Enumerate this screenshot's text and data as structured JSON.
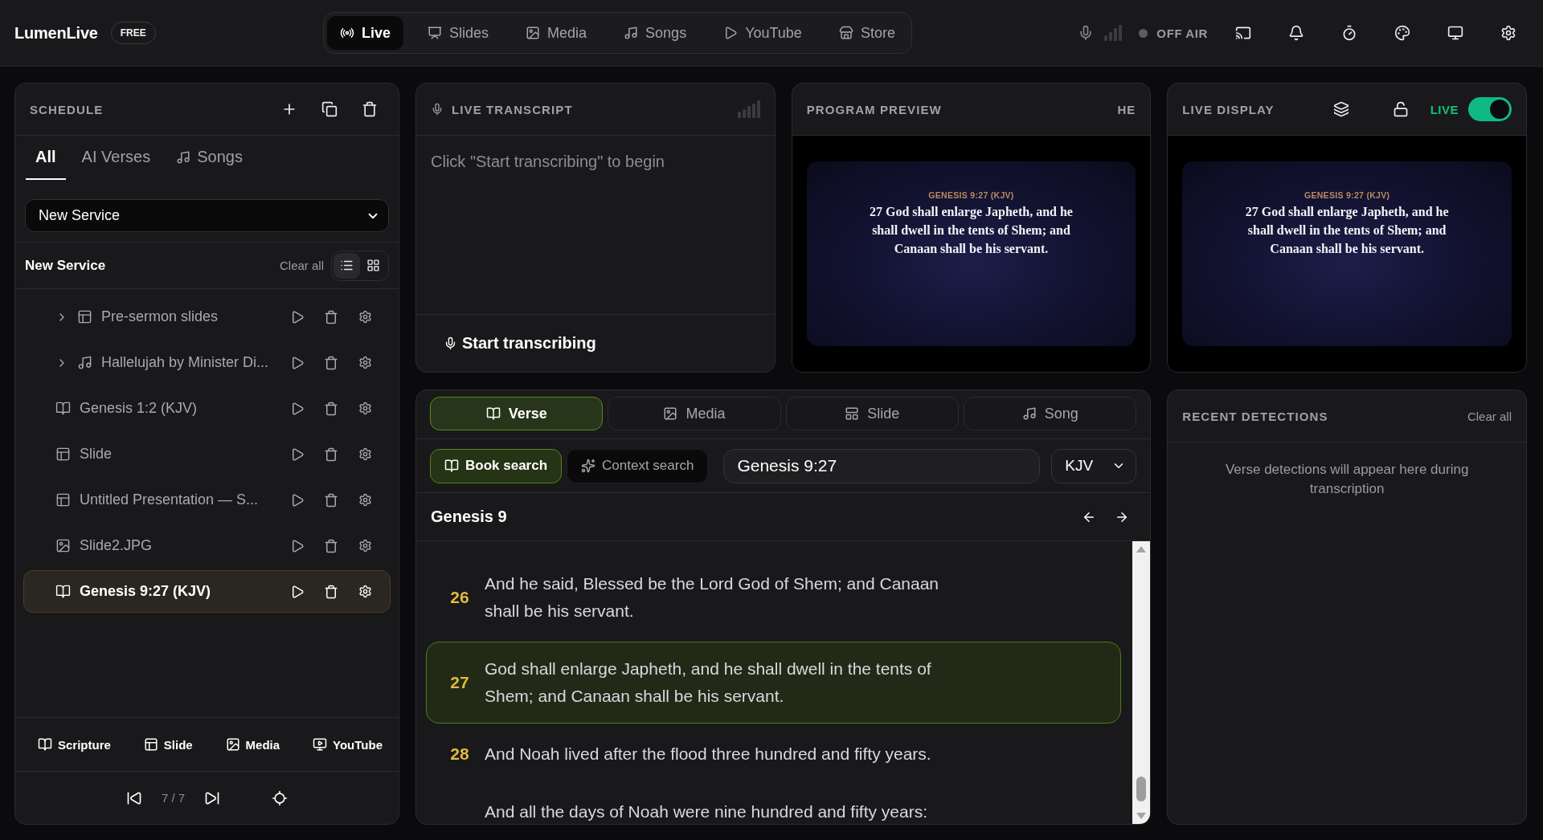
{
  "app": {
    "name": "LumenLive",
    "badge": "FREE"
  },
  "nav": [
    {
      "label": "Live",
      "selected": true
    },
    {
      "label": "Slides",
      "selected": false
    },
    {
      "label": "Media",
      "selected": false
    },
    {
      "label": "Songs",
      "selected": false
    },
    {
      "label": "YouTube",
      "selected": false
    },
    {
      "label": "Store",
      "selected": false
    }
  ],
  "broadcast": {
    "label": "OFF AIR",
    "on_air": false
  },
  "schedule": {
    "title": "SCHEDULE",
    "tabs": [
      {
        "label": "All",
        "selected": true
      },
      {
        "label": "AI Verses",
        "selected": false
      },
      {
        "label": "Songs",
        "selected": false
      }
    ],
    "service": "New Service",
    "list_title": "New Service",
    "clear_label": "Clear all",
    "views": [
      {
        "kind": "list",
        "selected": true
      },
      {
        "kind": "grid",
        "selected": false
      }
    ],
    "items": [
      {
        "label": "Pre-sermon slides",
        "kind": "slides",
        "expanded": false,
        "selected": false
      },
      {
        "label": "Hallelujah by Minister Di...",
        "kind": "song",
        "expanded": false,
        "selected": false
      },
      {
        "label": "Genesis 1:2 (KJV)",
        "kind": "scripture",
        "selected": false
      },
      {
        "label": "Slide",
        "kind": "slide",
        "selected": false
      },
      {
        "label": "Untitled Presentation — S...",
        "kind": "slide",
        "selected": false
      },
      {
        "label": "Slide2.JPG",
        "kind": "image",
        "selected": false
      },
      {
        "label": "Genesis 9:27 (KJV)",
        "kind": "scripture",
        "selected": true
      }
    ],
    "add_buttons": [
      "Scripture",
      "Slide",
      "Media",
      "YouTube"
    ],
    "position": "7 / 7"
  },
  "transcript": {
    "title": "LIVE TRANSCRIPT",
    "empty_message": "Click \"Start transcribing\" to begin",
    "start_label": "Start transcribing"
  },
  "program_preview": {
    "title": "PROGRAM PREVIEW",
    "badge": "HE",
    "slide": {
      "reference": "GENESIS 9:27 (KJV)",
      "text": "27 God shall enlarge Japheth, and he shall dwell in the tents of Shem; and Canaan shall be his servant."
    }
  },
  "live_display": {
    "title": "LIVE DISPLAY",
    "live_label": "LIVE",
    "on": true,
    "slide": {
      "reference": "GENESIS 9:27 (KJV)",
      "text": "27 God shall enlarge Japheth, and he shall dwell in the tents of Shem; and Canaan shall be his servant."
    }
  },
  "bible": {
    "tabs": [
      {
        "label": "Verse",
        "selected": true
      },
      {
        "label": "Media",
        "selected": false
      },
      {
        "label": "Slide",
        "selected": false
      },
      {
        "label": "Song",
        "selected": false
      }
    ],
    "search_modes": [
      {
        "label": "Book search",
        "selected": true
      },
      {
        "label": "Context search",
        "selected": false
      }
    ],
    "query": "Genesis 9:27",
    "translation": "KJV",
    "chapter": "Genesis 9",
    "verses": [
      {
        "number": "26",
        "text": "And he said, Blessed be the Lord God of Shem; and Canaan shall be his servant.",
        "selected": false
      },
      {
        "number": "27",
        "text": "God shall enlarge Japheth, and he shall dwell in the tents of Shem; and Canaan shall be his servant.",
        "selected": true
      },
      {
        "number": "28",
        "text": "And Noah lived after the flood three hundred and fifty years.",
        "selected": false
      },
      {
        "text": "And all the days of Noah were nine hundred and fifty years:",
        "selected": false
      }
    ]
  },
  "detections": {
    "title": "RECENT DETECTIONS",
    "clear_label": "Clear all",
    "empty_message": "Verse detections will appear here during transcription"
  }
}
